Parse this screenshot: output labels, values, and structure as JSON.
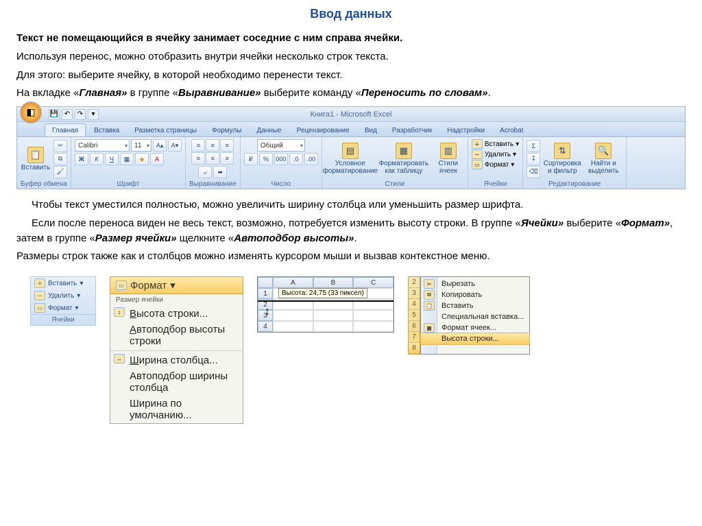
{
  "title": "Ввод данных",
  "p1": "Текст не помещающийся в ячейку занимает соседние с ним справа ячейки.",
  "p2": "Используя перенос, можно отобразить внутри ячейки несколько строк текста.",
  "p3": "Для этого: выберите ячейку, в которой необходимо перенести текст.",
  "p4a": "На вкладке «",
  "p4b": "Главная»",
  "p4c": " в группе «",
  "p4d": "Выравнивание»",
  "p4e": " выберите команду «",
  "p4f": "Переносить по словам»",
  "p4g": ".",
  "p5a": "Чтобы текст уместился полностью, можно увеличить ширину столбца или уменьшить размер шрифта.",
  "p6a": "Если после переноса виден не весь текст, возможно, потребуется изменить высоту строки. В группе «",
  "p6b": "Ячейки»",
  "p6c": " выберите «",
  "p6d": "Формат»",
  "p6e": ", затем в группе «",
  "p6f": "Размер ячейки»",
  "p6g": " щелкните «",
  "p6h": "Автоподбор высоты»",
  "p6i": ".",
  "p7": "Размеры строк также как и столбцов можно изменять курсором мыши и вызвав контекстное меню.",
  "ribbon": {
    "wintitle": "Книга1 - Microsoft Excel",
    "tabs": [
      "Главная",
      "Вставка",
      "Разметка страницы",
      "Формулы",
      "Данные",
      "Рецензирование",
      "Вид",
      "Разработчик",
      "Надстройки",
      "Acrobat"
    ],
    "font_name": "Calibri",
    "font_size": "11",
    "number_fmt": "Общий",
    "paste": "Вставить",
    "g_clip": "Буфер обмена",
    "g_font": "Шрифт",
    "g_align": "Выравнивание",
    "g_num": "Число",
    "g_styles": "Стили",
    "g_cells": "Ячейки",
    "g_edit": "Редактирование",
    "cond": "Условное форматирование",
    "table": "Форматировать как таблицу",
    "cellstyle": "Стили ячеек",
    "insert": "Вставить",
    "delete": "Удалить",
    "format": "Формат",
    "sort": "Сортировка и фильтр",
    "find": "Найти и выделить"
  },
  "cells": {
    "insert": "Вставить",
    "delete": "Удалить",
    "format": "Формат",
    "label": "Ячейки"
  },
  "fmt": {
    "button": "Формат",
    "head": "Размер ячейки",
    "i1": "Высота строки...",
    "i2": "Автоподбор высоты строки",
    "i3": "Ширина столбца...",
    "i4": "Автоподбор ширины столбца",
    "i5": "Ширина по умолчанию..."
  },
  "sheet": {
    "colA": "A",
    "colB": "B",
    "colC": "C",
    "tooltip": "Высота: 24,75 (33 пиксел)"
  },
  "ctx": {
    "rows": [
      "2",
      "3",
      "4",
      "5",
      "6",
      "7",
      "8"
    ],
    "cut": "Вырезать",
    "copy": "Копировать",
    "paste": "Вставить",
    "paste_sp": "Специальная вставка...",
    "fmt_cells": "Формат ячеек...",
    "row_h": "Высота строки..."
  }
}
